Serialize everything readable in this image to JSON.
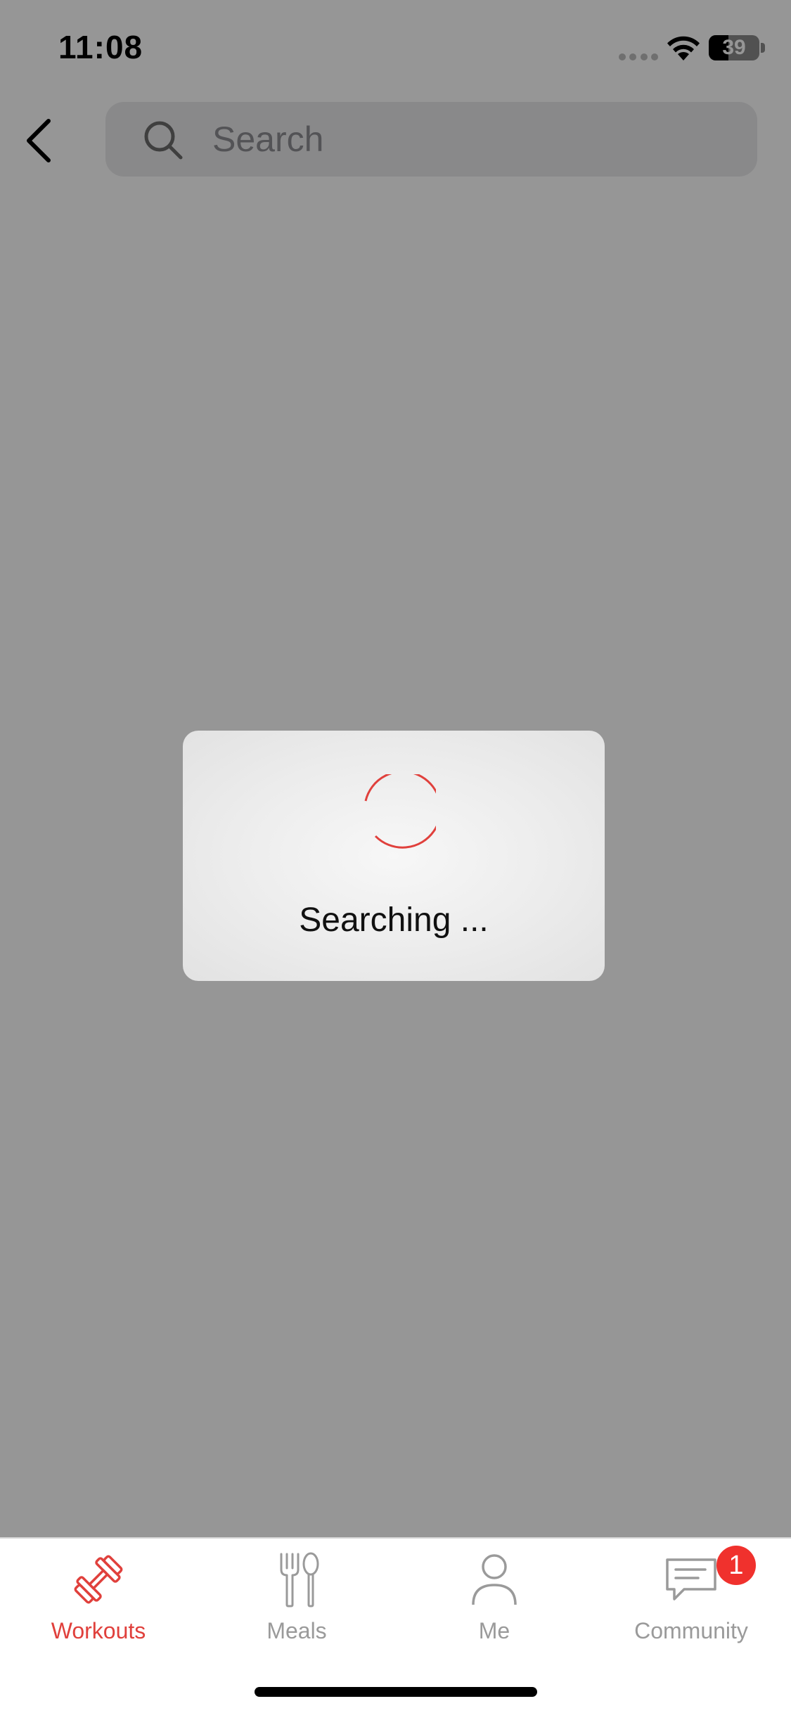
{
  "status_bar": {
    "time": "11:08",
    "battery": "39",
    "battery_level": 0.39
  },
  "search": {
    "placeholder": "Search"
  },
  "loading": {
    "text": "Searching ...",
    "spinner_color": "#e0403c"
  },
  "tabs": [
    {
      "label": "Workouts",
      "icon": "dumbbell-icon",
      "active": true
    },
    {
      "label": "Meals",
      "icon": "fork-spoon-icon",
      "active": false
    },
    {
      "label": "Me",
      "icon": "person-icon",
      "active": false
    },
    {
      "label": "Community",
      "icon": "chat-icon",
      "active": false,
      "badge": "1"
    }
  ],
  "colors": {
    "accent": "#e0403c",
    "badge": "#f0312d",
    "inactive": "#9a9a9a"
  }
}
